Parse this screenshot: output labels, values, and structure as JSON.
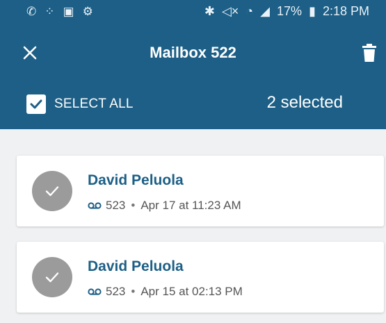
{
  "status_bar": {
    "battery": "17%",
    "time": "2:18 PM",
    "left_icons": [
      "phone-icon",
      "apps-icon",
      "image-icon",
      "usb-icon"
    ],
    "right_icons": [
      "bluetooth-icon",
      "mute-icon",
      "wifi-icon",
      "signal-icon",
      "battery-icon"
    ]
  },
  "header": {
    "title": "Mailbox 522",
    "close_icon": "close-icon",
    "delete_icon": "trash-icon"
  },
  "selection": {
    "select_all_label": "SELECT ALL",
    "selected_count": "2 selected",
    "checked": true
  },
  "messages": [
    {
      "name": "David Peluola",
      "extension": "523",
      "separator": "•",
      "date": "Apr 17 at 11:23 AM",
      "selected": true
    },
    {
      "name": "David Peluola",
      "extension": "523",
      "separator": "•",
      "date": "Apr 15 at 02:13 PM",
      "selected": true
    }
  ],
  "colors": {
    "header": "#1d5f86",
    "name_text": "#1d5f86",
    "avatar": "#9b9b9b",
    "background": "#f0f1f3"
  }
}
